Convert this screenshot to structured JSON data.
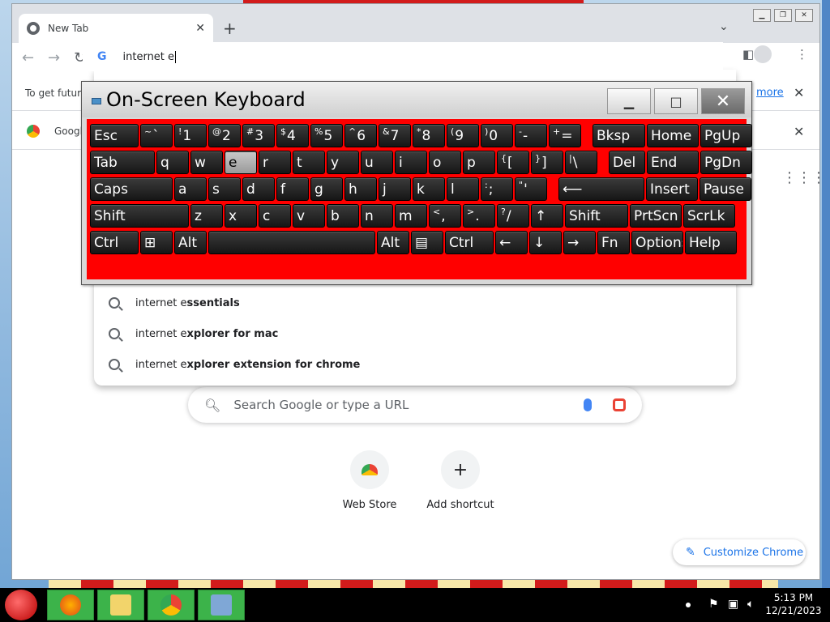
{
  "browser": {
    "tab_title": "New Tab",
    "new_tab_symbol": "+",
    "omnibox_text": "internet e",
    "infobar_text": "To get future",
    "infobar_link": "more",
    "bookmark_label": "Googl"
  },
  "suggestions": [
    {
      "prefix": "internet e",
      "bold": "ssentials"
    },
    {
      "prefix": "internet e",
      "bold": "xplorer for mac"
    },
    {
      "prefix": "internet e",
      "bold": "xplorer extension for chrome"
    }
  ],
  "ntp": {
    "search_placeholder": "Search Google or type a URL",
    "shortcuts": [
      {
        "label": "Web Store",
        "icon": "web-store-icon"
      },
      {
        "label": "Add shortcut",
        "icon": "plus-icon",
        "symbol": "+"
      }
    ],
    "customize_label": "Customize Chrome"
  },
  "osk": {
    "title": "On-Screen Keyboard",
    "rows": [
      [
        {
          "label": "Esc",
          "w": 60
        },
        {
          "sup": "~",
          "label": "`",
          "w": 40
        },
        {
          "sup": "!",
          "label": "1",
          "w": 40
        },
        {
          "sup": "@",
          "label": "2",
          "w": 40
        },
        {
          "sup": "#",
          "label": "3",
          "w": 40
        },
        {
          "sup": "$",
          "label": "4",
          "w": 40
        },
        {
          "sup": "%",
          "label": "5",
          "w": 40
        },
        {
          "sup": "^",
          "label": "6",
          "w": 40
        },
        {
          "sup": "&",
          "label": "7",
          "w": 40
        },
        {
          "sup": "*",
          "label": "8",
          "w": 40
        },
        {
          "sup": "(",
          "label": "9",
          "w": 40
        },
        {
          "sup": ")",
          "label": "0",
          "w": 40
        },
        {
          "sup": "-",
          "label": "-",
          "w": 40
        },
        {
          "sup": "+",
          "label": "=",
          "w": 40
        },
        {
          "label": "Bksp",
          "w": 65,
          "gap": 12
        },
        {
          "label": "Home",
          "w": 64
        },
        {
          "label": "PgUp",
          "w": 64
        }
      ],
      [
        {
          "label": "Tab",
          "w": 80
        },
        {
          "label": "q",
          "w": 40
        },
        {
          "label": "w",
          "w": 40
        },
        {
          "label": "e",
          "w": 40,
          "pressed": true
        },
        {
          "label": "r",
          "w": 40
        },
        {
          "label": "t",
          "w": 40
        },
        {
          "label": "y",
          "w": 40
        },
        {
          "label": "u",
          "w": 40
        },
        {
          "label": "i",
          "w": 40
        },
        {
          "label": "o",
          "w": 40
        },
        {
          "label": "p",
          "w": 40
        },
        {
          "sup": "{",
          "label": "[",
          "w": 40
        },
        {
          "sup": "}",
          "label": "]",
          "w": 40
        },
        {
          "sup": "|",
          "label": "\\",
          "w": 40
        },
        {
          "label": "Del",
          "w": 45,
          "gap": 12
        },
        {
          "label": "End",
          "w": 64
        },
        {
          "label": "PgDn",
          "w": 64
        }
      ],
      [
        {
          "label": "Caps",
          "w": 102
        },
        {
          "label": "a",
          "w": 40
        },
        {
          "label": "s",
          "w": 40
        },
        {
          "label": "d",
          "w": 40
        },
        {
          "label": "f",
          "w": 40
        },
        {
          "label": "g",
          "w": 40
        },
        {
          "label": "h",
          "w": 40
        },
        {
          "label": "j",
          "w": 40
        },
        {
          "label": "k",
          "w": 40
        },
        {
          "label": "l",
          "w": 40
        },
        {
          "sup": ":",
          "label": ";",
          "w": 40
        },
        {
          "sup": "\"",
          "label": "'",
          "w": 40
        },
        {
          "label": "⟵",
          "w": 106,
          "gap": 12
        },
        {
          "label": "Insert",
          "w": 64
        },
        {
          "label": "Pause",
          "w": 64
        }
      ],
      [
        {
          "label": "Shift",
          "w": 122
        },
        {
          "label": "z",
          "w": 40
        },
        {
          "label": "x",
          "w": 40
        },
        {
          "label": "c",
          "w": 40
        },
        {
          "label": "v",
          "w": 40
        },
        {
          "label": "b",
          "w": 40
        },
        {
          "label": "n",
          "w": 40
        },
        {
          "label": "m",
          "w": 40
        },
        {
          "sup": "<",
          "label": ",",
          "w": 40
        },
        {
          "sup": ">",
          "label": ".",
          "w": 40
        },
        {
          "sup": "?",
          "label": "/",
          "w": 40
        },
        {
          "label": "↑",
          "w": 40
        },
        {
          "label": "Shift",
          "w": 78
        },
        {
          "label": "PrtScn",
          "w": 64
        },
        {
          "label": "ScrLk",
          "w": 64
        }
      ],
      [
        {
          "label": "Ctrl",
          "w": 60
        },
        {
          "label": "⊞",
          "w": 40,
          "icon": "windows-icon"
        },
        {
          "label": "Alt",
          "w": 40
        },
        {
          "label": "",
          "w": 206
        },
        {
          "label": "Alt",
          "w": 40
        },
        {
          "label": "▤",
          "w": 40,
          "icon": "menu-icon"
        },
        {
          "label": "Ctrl",
          "w": 60
        },
        {
          "label": "←",
          "w": 40
        },
        {
          "label": "↓",
          "w": 40
        },
        {
          "label": "→",
          "w": 40
        },
        {
          "label": "Fn",
          "w": 40
        },
        {
          "label": "Options",
          "w": 64
        },
        {
          "label": "Help",
          "w": 64
        }
      ]
    ]
  },
  "taskbar": {
    "time": "5:13 PM",
    "date": "12/21/2023"
  },
  "colors": {
    "osk_panel": "#ff0000",
    "taskbar_app": "#3cb34a",
    "link": "#1a73e8"
  }
}
